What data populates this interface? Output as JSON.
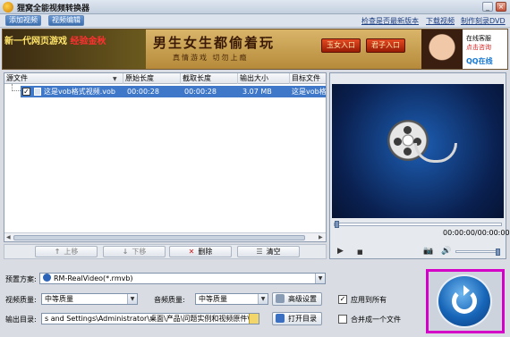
{
  "window": {
    "title": "狸窝全能视频转换器",
    "minimize_label": "_",
    "close_label": "×"
  },
  "toolbar": {
    "add_video_label": "添加视频",
    "edit_video_label": "视频编辑",
    "check_update_link": "检查是否最新版本",
    "download_link": "下载视频",
    "burn_dvd_link": "制作刻录DVD"
  },
  "banner": {
    "left_text_a": "新一代网页游戏",
    "left_text_b": "经验金秋",
    "slogan": "男生女生都偷着玩",
    "subtitle": "真情游戏  切勿上瘾",
    "entry_1": "玉女入口",
    "entry_2": "君子入口",
    "qq_line1": "在线客服",
    "qq_line2": "点击咨询",
    "qq_logo": "QQ在线"
  },
  "file_list": {
    "columns": [
      "源文件",
      "原始长度",
      "截取长度",
      "输出大小",
      "目标文件"
    ],
    "rows": [
      {
        "checked": "✓",
        "name": "这是vob格式视频.vob",
        "original_length": "00:00:28",
        "clip_length": "00:00:28",
        "output_size": "3.07 MB",
        "target": "这是vob格"
      }
    ]
  },
  "actions": {
    "move_up": "上移",
    "move_down": "下移",
    "delete": "删除",
    "clear": "清空"
  },
  "player": {
    "time": "00:00:00/00:00:00",
    "play_icon": "▶",
    "stop_icon": "■",
    "camera_icon": "📷",
    "volume_icon": "🔊"
  },
  "settings": {
    "preset_label": "预置方案:",
    "preset_value": "RM-RealVideo(*.rmvb)",
    "video_quality_label": "视频质量:",
    "video_quality_value": "中等质量",
    "audio_quality_label": "音频质量:",
    "audio_quality_value": "中等质量",
    "advanced_button": "高级设置",
    "apply_all_label": "应用到所有",
    "apply_all_checked": "✓",
    "output_dir_label": "输出目录:",
    "output_dir_value": "s and Settings\\Administrator\\桌面\\产品\\问题实例和视频原件\\转换",
    "open_dir_button": "打开目录",
    "merge_label": "合并成一个文件"
  },
  "colors": {
    "selection": "#3f78c8",
    "highlight_frame": "#d500c8",
    "convert_button": "#1765b8"
  }
}
